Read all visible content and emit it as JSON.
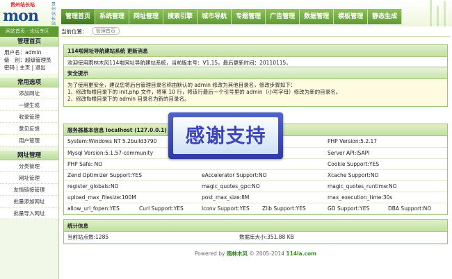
{
  "logo": {
    "site_name": "贵州站长站",
    "wordmark": "mon",
    "vertical_text": "贵州站长站"
  },
  "nav": [
    {
      "label": "管理首页",
      "active": true
    },
    {
      "label": "系统管理"
    },
    {
      "label": "网址管理"
    },
    {
      "label": "搜索引擎"
    },
    {
      "label": "城市导航"
    },
    {
      "label": "专题管理"
    },
    {
      "label": "广告管理"
    },
    {
      "label": "数据管理"
    },
    {
      "label": "模板管理"
    },
    {
      "label": "静态生成"
    }
  ],
  "sidebar": {
    "top_links": "网站首页 · 论坛专区",
    "home_title": "管理首页",
    "username_line": "用户名：admin",
    "level_line": "级　别：超级管理员",
    "account_links": "密码 | 主页 | 退出",
    "section_common": "常用选项",
    "common_items": [
      "添加网址",
      "一键生成",
      "收录管理",
      "意见反馈",
      "用户管理"
    ],
    "section_url": "网址管理",
    "url_items": [
      "分类管理",
      "网址管理",
      "友情链接管理",
      "批量添加网址",
      "批量导入网址"
    ]
  },
  "breadcrumb": {
    "label": "当前位置：",
    "page": "管理首页"
  },
  "news": {
    "title": "114啦网址导航建站系统 更新消息",
    "body": "欢迎使用雨林木风114啦网址导航建站系统，当前版本号：V1.15，最后更新时间：20110115。"
  },
  "safety": {
    "title": "安全提示",
    "line1": "为了使用更安全，建议您将后台管理目录名称由默认的 admin 修改为其他目录名，修改步骤如下：",
    "line2": "1、修改fb根目录下的 init.php 文件，将第 10 行，将该行最后一个引号里的 admin（小写字母）修改为新的目录名。",
    "line3": "2、修改fb根目录下的 admin 目录名为新的目录名。"
  },
  "server": {
    "title": "服务器基本信息 localhost (127.0.0.1) 2011",
    "rows": [
      [
        "System:Windows NT 5.2build3790",
        "",
        "PHP Version:5.2.17"
      ],
      [
        "Mysql Version:5.1.57-community",
        "",
        "Server API:ISAPI"
      ],
      [
        "PHP Safe: NO",
        "",
        "Cookie Support:YES"
      ],
      [
        "Zend Optimizer Support:YES",
        "eAccelerator Support:NO",
        "Xcache Support:NO"
      ],
      [
        "register_globals:NO",
        "magic_quotes_gpc:NO",
        "magic_quotes_runtime:NO"
      ],
      [
        "upload_max_filesize:100M",
        "post_max_size:8M",
        "max_execution_time:30s"
      ]
    ],
    "last_row": [
      "allow_url_fopen:YES",
      "Curl Support:YES",
      "Iconv Support:YES",
      "Zlib Support:YES",
      "GD Support:YES",
      "DBA Support:NO"
    ]
  },
  "stats": {
    "title": "统计信息",
    "site_count": "当前站点数:1285",
    "db_size": "数据库大小:351.88 KB"
  },
  "footer": {
    "powered": "Powered by",
    "brand": "雨林木风",
    "copyright": "© 2005-2014",
    "domain": "114la.com"
  },
  "badge": {
    "text": "感谢支持"
  }
}
